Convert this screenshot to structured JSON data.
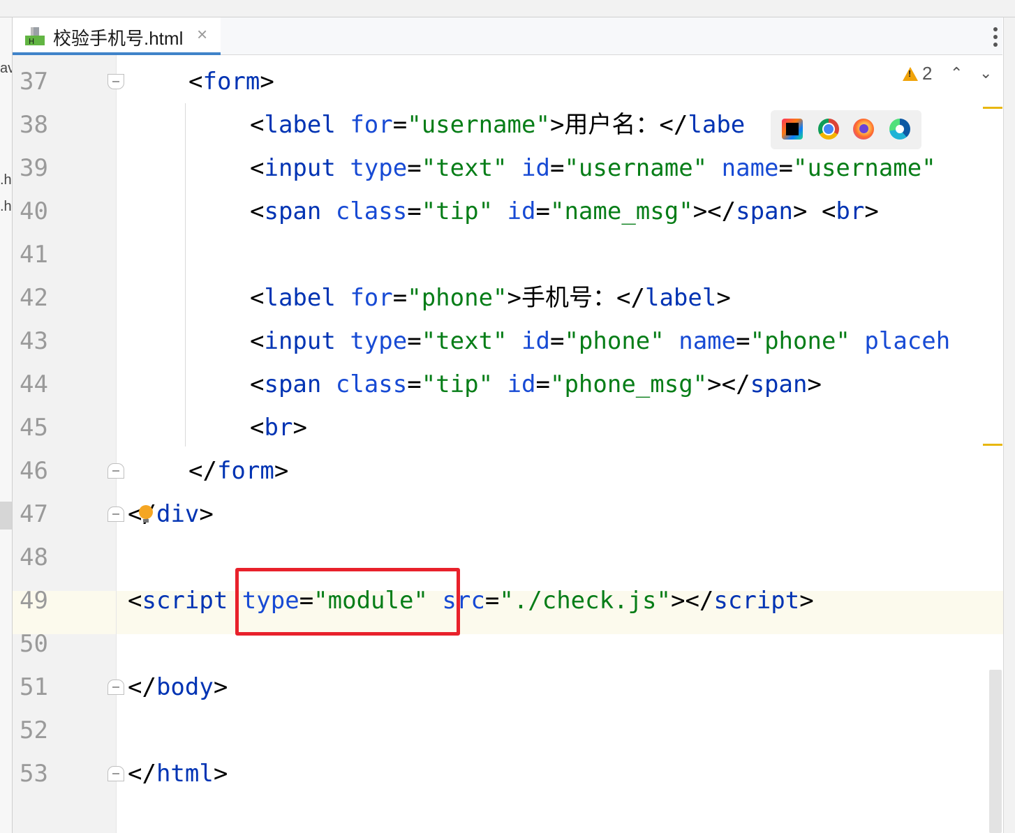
{
  "editor_tab": {
    "file_name": "校验手机号.html",
    "close_glyph": "×",
    "icon": "html-file-icon"
  },
  "left_panel": {
    "fragments": [
      "av",
      ".h",
      ".h"
    ]
  },
  "inspections": {
    "warning_count": "2",
    "up_glyph": "⌃",
    "down_glyph": "⌄"
  },
  "browser_icons": [
    "intellij-icon",
    "chrome-icon",
    "firefox-icon",
    "edge-icon"
  ],
  "line_numbers": [
    "37",
    "38",
    "39",
    "40",
    "41",
    "42",
    "43",
    "44",
    "45",
    "46",
    "47",
    "48",
    "49",
    "50",
    "51",
    "52",
    "53"
  ],
  "code": {
    "l37": [
      "<",
      "form",
      ">"
    ],
    "l38": [
      "<",
      "label",
      " ",
      "for",
      "=",
      "\"username\"",
      ">",
      "用户名：",
      "</",
      "labe"
    ],
    "l39": [
      "<",
      "input",
      " ",
      "type",
      "=",
      "\"text\"",
      " ",
      "id",
      "=",
      "\"username\"",
      " ",
      "name",
      "=",
      "\"username\""
    ],
    "l40": [
      "<",
      "span",
      " ",
      "class",
      "=",
      "\"tip\"",
      " ",
      "id",
      "=",
      "\"name_msg\"",
      "></",
      "span",
      "> <",
      "br",
      ">"
    ],
    "l42": [
      "<",
      "label",
      " ",
      "for",
      "=",
      "\"phone\"",
      ">",
      "手机号：",
      "</",
      "label",
      ">"
    ],
    "l43": [
      "<",
      "input",
      " ",
      "type",
      "=",
      "\"text\"",
      " ",
      "id",
      "=",
      "\"phone\"",
      " ",
      "name",
      "=",
      "\"phone\"",
      " ",
      "placeh"
    ],
    "l44": [
      "<",
      "span",
      " ",
      "class",
      "=",
      "\"tip\"",
      " ",
      "id",
      "=",
      "\"phone_msg\"",
      "></",
      "span",
      ">"
    ],
    "l45": [
      "<",
      "br",
      ">"
    ],
    "l46": [
      "</",
      "form",
      ">"
    ],
    "l47": [
      "<",
      "/",
      "div",
      ">"
    ],
    "l49": [
      "<",
      "script",
      " ",
      "type",
      "=",
      "\"module\"",
      " ",
      "src",
      "=",
      "\"./check.js\"",
      "></",
      "script",
      ">"
    ],
    "l51": [
      "</",
      "body",
      ">"
    ],
    "l53": [
      "</",
      "html",
      ">"
    ]
  },
  "colors": {
    "tag": "#0033b3",
    "attribute": "#174ad4",
    "string": "#067d17",
    "highlight_box": "#e8212b",
    "current_line": "#fcfaed",
    "tab_underline": "#4083c9",
    "warning": "#f0a30a"
  }
}
